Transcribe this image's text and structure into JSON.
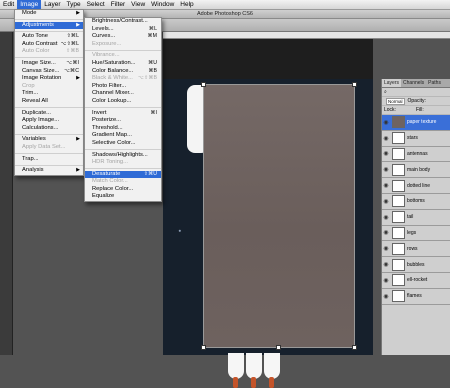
{
  "menubar": {
    "items": [
      "Edit",
      "Image",
      "Layer",
      "Type",
      "Select",
      "Filter",
      "View",
      "Window",
      "Help"
    ]
  },
  "window": {
    "title": "Adobe Photoshop CS6"
  },
  "image_menu": [
    {
      "label": "Mode",
      "submenu": true
    },
    {
      "sep": true
    },
    {
      "label": "Adjustments",
      "submenu": true,
      "highlighted": true
    },
    {
      "sep": true
    },
    {
      "label": "Auto Tone",
      "shortcut": "⇧⌘L"
    },
    {
      "label": "Auto Contrast",
      "shortcut": "⌥⇧⌘L"
    },
    {
      "label": "Auto Color",
      "shortcut": "⇧⌘B",
      "disabled": true
    },
    {
      "sep": true
    },
    {
      "label": "Image Size...",
      "shortcut": "⌥⌘I"
    },
    {
      "label": "Canvas Size...",
      "shortcut": "⌥⌘C"
    },
    {
      "label": "Image Rotation",
      "submenu": true
    },
    {
      "label": "Crop",
      "disabled": true
    },
    {
      "label": "Trim..."
    },
    {
      "label": "Reveal All"
    },
    {
      "sep": true
    },
    {
      "label": "Duplicate..."
    },
    {
      "label": "Apply Image..."
    },
    {
      "label": "Calculations..."
    },
    {
      "sep": true
    },
    {
      "label": "Variables",
      "submenu": true
    },
    {
      "label": "Apply Data Set...",
      "disabled": true
    },
    {
      "sep": true
    },
    {
      "label": "Trap..."
    },
    {
      "sep": true
    },
    {
      "label": "Analysis",
      "submenu": true
    }
  ],
  "adjustments_menu": [
    {
      "label": "Brightness/Contrast..."
    },
    {
      "label": "Levels...",
      "shortcut": "⌘L"
    },
    {
      "label": "Curves...",
      "shortcut": "⌘M"
    },
    {
      "label": "Exposure...",
      "disabled": true
    },
    {
      "sep": true
    },
    {
      "label": "Vibrance...",
      "disabled": true
    },
    {
      "label": "Hue/Saturation...",
      "shortcut": "⌘U"
    },
    {
      "label": "Color Balance...",
      "shortcut": "⌘B"
    },
    {
      "label": "Black & White...",
      "shortcut": "⌥⇧⌘B",
      "disabled": true
    },
    {
      "label": "Photo Filter..."
    },
    {
      "label": "Channel Mixer..."
    },
    {
      "label": "Color Lookup..."
    },
    {
      "sep": true
    },
    {
      "label": "Invert",
      "shortcut": "⌘I"
    },
    {
      "label": "Posterize..."
    },
    {
      "label": "Threshold..."
    },
    {
      "label": "Gradient Map..."
    },
    {
      "label": "Selective Color..."
    },
    {
      "sep": true
    },
    {
      "label": "Shadows/Highlights..."
    },
    {
      "label": "HDR Toning...",
      "disabled": true
    },
    {
      "sep": true
    },
    {
      "label": "Desaturate",
      "shortcut": "⇧⌘U",
      "highlighted": true
    },
    {
      "label": "Match Color...",
      "disabled": true
    },
    {
      "label": "Replace Color..."
    },
    {
      "label": "Equalize"
    }
  ],
  "layers_panel": {
    "tabs": [
      "Layers",
      "Channels",
      "Paths"
    ],
    "blend_mode": "Normal",
    "opacity_label": "Opacity:",
    "fill_label": "Fill:",
    "lock_label": "Lock:",
    "layers": [
      {
        "name": "paper texture",
        "selected": true
      },
      {
        "name": "stars"
      },
      {
        "name": "antennas"
      },
      {
        "name": "main body"
      },
      {
        "name": "dotted line"
      },
      {
        "name": "bottoms"
      },
      {
        "name": "tail"
      },
      {
        "name": "legs"
      },
      {
        "name": "rows"
      },
      {
        "name": "bubbles"
      },
      {
        "name": "ell-rocket"
      },
      {
        "name": "flames"
      }
    ]
  }
}
